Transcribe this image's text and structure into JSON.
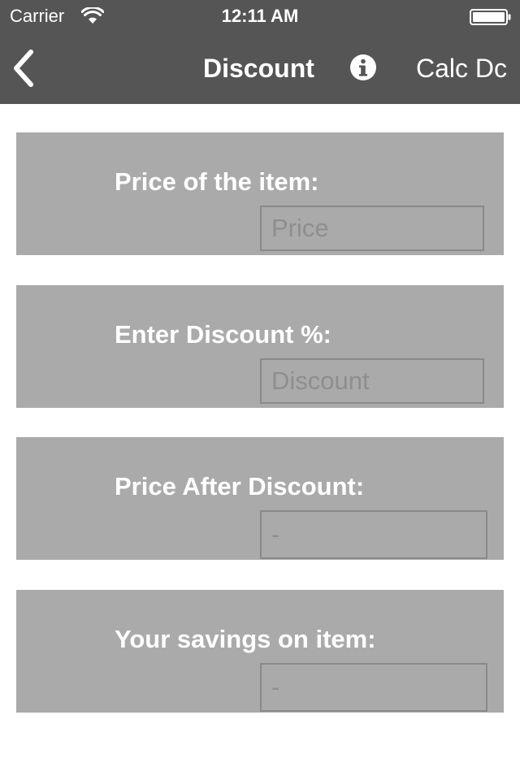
{
  "status_bar": {
    "carrier": "Carrier",
    "time": "12:11 AM",
    "wifi_icon": "wifi-icon",
    "battery_icon": "battery-icon"
  },
  "nav_bar": {
    "back_icon": "chevron-left-icon",
    "title": "Discount",
    "info_icon": "info-icon",
    "right_button_label": "Calc Dc"
  },
  "form": {
    "price": {
      "label": "Price of the item:",
      "value": "",
      "placeholder": "Price"
    },
    "discount": {
      "label": "Enter Discount %:",
      "value": "",
      "placeholder": "Discount"
    },
    "price_after": {
      "label": "Price After Discount:",
      "value": "-"
    },
    "savings": {
      "label": "Your savings on item:",
      "value": "-"
    }
  },
  "colors": {
    "nav_background": "#555555",
    "card_background": "#aaaaaa",
    "label_text": "#ffffff",
    "field_text": "#8e8e8e",
    "field_border": "#8a8a8a"
  }
}
